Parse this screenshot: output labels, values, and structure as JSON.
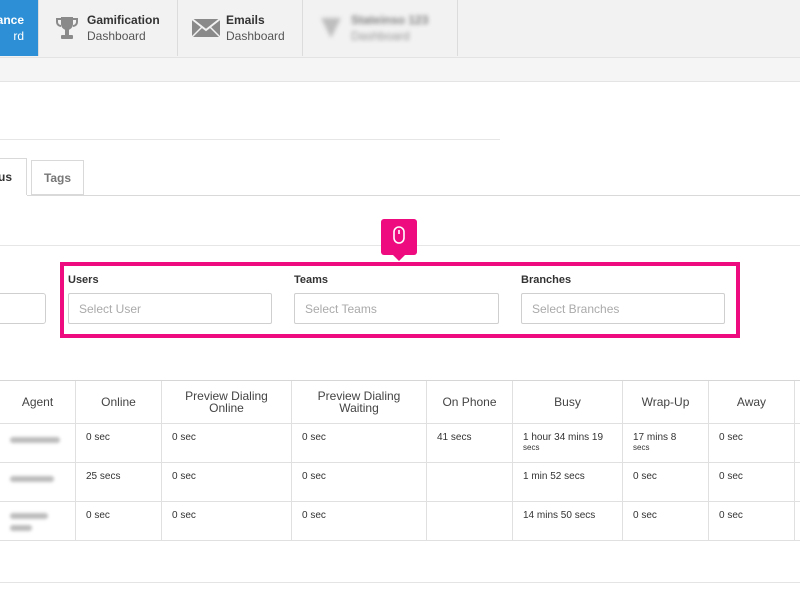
{
  "nav": {
    "tabs": [
      {
        "line1": "ance",
        "line2": "rd"
      },
      {
        "line1": "Gamification",
        "line2": "Dashboard",
        "icon": "trophy-icon"
      },
      {
        "line1": "Emails",
        "line2": "Dashboard",
        "icon": "envelope-icon"
      },
      {
        "line1": "Stateinso 123",
        "line2": "Dashboard",
        "icon": "blurred-icon"
      }
    ]
  },
  "subtabs": {
    "status": "us",
    "tags": "Tags"
  },
  "callout": {
    "icon": "mouse-icon"
  },
  "filters": {
    "users": {
      "label": "Users",
      "placeholder": "Select User"
    },
    "teams": {
      "label": "Teams",
      "placeholder": "Select Teams"
    },
    "branches": {
      "label": "Branches",
      "placeholder": "Select Branches"
    }
  },
  "table": {
    "headers": [
      {
        "line1": "Agent",
        "line2": ""
      },
      {
        "line1": "Online",
        "line2": ""
      },
      {
        "line1": "Preview Dialing",
        "line2": "Online"
      },
      {
        "line1": "Preview Dialing",
        "line2": "Waiting"
      },
      {
        "line1": "On Phone",
        "line2": ""
      },
      {
        "line1": "Busy",
        "line2": ""
      },
      {
        "line1": "Wrap-Up",
        "line2": ""
      },
      {
        "line1": "Away",
        "line2": ""
      }
    ],
    "rows": [
      {
        "online": "0 sec",
        "pd_online": "0 sec",
        "pd_waiting": "0 sec",
        "on_phone": "41 secs",
        "busy_1": "1 hour 34 mins 19",
        "busy_2": "secs",
        "wrap_1": "17 mins 8",
        "wrap_2": "secs",
        "away": "0 sec"
      },
      {
        "online": "25 secs",
        "pd_online": "0 sec",
        "pd_waiting": "0 sec",
        "on_phone": "",
        "busy_1": "1 min 52 secs",
        "busy_2": "",
        "wrap_1": "0 sec",
        "wrap_2": "",
        "away": "0 sec"
      },
      {
        "online": "0 sec",
        "pd_online": "0 sec",
        "pd_waiting": "0 sec",
        "on_phone": "",
        "busy_1": "14 mins 50 secs",
        "busy_2": "",
        "wrap_1": "0 sec",
        "wrap_2": "",
        "away": "0 sec"
      }
    ]
  },
  "colors": {
    "accent": "#ed0b7f",
    "active_tab": "#2d8fd5"
  }
}
